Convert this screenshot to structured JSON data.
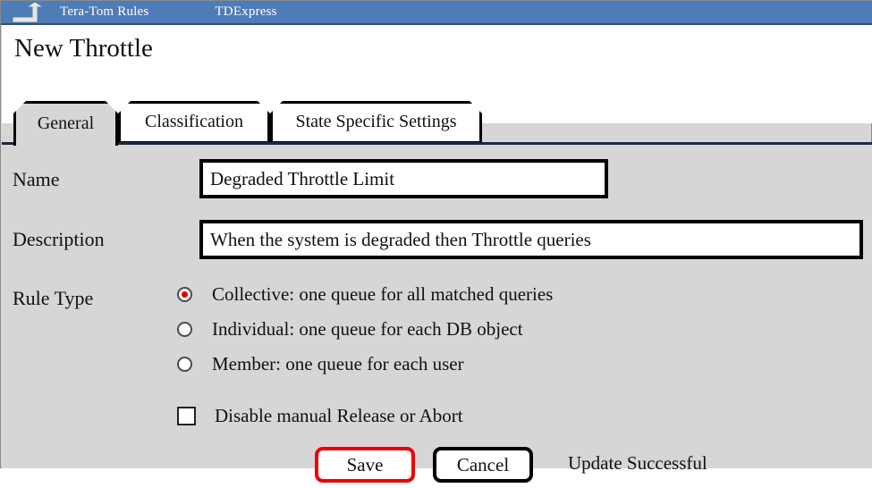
{
  "window": {
    "icon": "window-restore-icon",
    "app_name": "Tera-Tom Rules",
    "system_name": "TDExpress"
  },
  "page": {
    "title": "New Throttle"
  },
  "tabs": [
    {
      "label": "General",
      "active": true
    },
    {
      "label": "Classification",
      "active": false
    },
    {
      "label": "State Specific Settings",
      "active": false
    }
  ],
  "form": {
    "name": {
      "label": "Name",
      "value": "Degraded Throttle Limit",
      "placeholder": ""
    },
    "description": {
      "label": "Description",
      "value": "When the system is degraded then Throttle queries",
      "placeholder": ""
    },
    "rule_type": {
      "label": "Rule Type",
      "selected": "Collective",
      "options": [
        {
          "label": "Collective:  one queue for all matched queries",
          "checked": true
        },
        {
          "label": "Individual: one queue for each DB object",
          "checked": false
        },
        {
          "label": "Member: one queue for each user",
          "checked": false
        }
      ]
    },
    "disable_manual": {
      "label": "Disable manual Release or Abort",
      "checked": false
    }
  },
  "actions": {
    "save_label": "Save",
    "cancel_label": "Cancel",
    "status_message": "Update Successful"
  },
  "colors": {
    "titlebar": "#4d7cb7",
    "body": "#d6d6d6",
    "accent_selected": "#e00000",
    "save_border": "#ee0000",
    "text": "#111111"
  }
}
